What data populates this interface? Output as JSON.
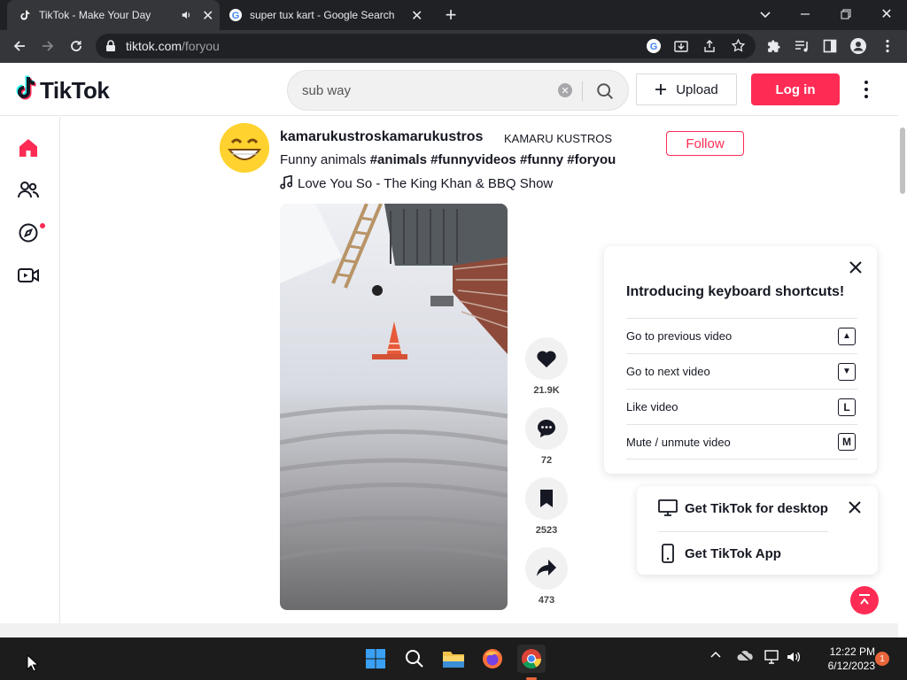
{
  "browser": {
    "tabs": [
      {
        "title": "TikTok - Make Your Day",
        "active": true
      },
      {
        "title": "super tux kart - Google Search",
        "active": false
      }
    ],
    "url_host": "tiktok.com",
    "url_path": "/foryou"
  },
  "header": {
    "logo": "TikTok",
    "search_value": "sub way",
    "upload_label": "Upload",
    "login_label": "Log in"
  },
  "post": {
    "username": "kamarukustroskamarukustros",
    "nickname": "KAMARU KUSTROS",
    "desc_text": "Funny animals ",
    "hashtags": "#animals #funnyvideos #funny #foryou",
    "music": "Love You So - The King Khan & BBQ Show",
    "follow_label": "Follow",
    "likes": "21.9K",
    "comments": "72",
    "saves": "2523",
    "shares": "473"
  },
  "shortcuts": {
    "title": "Introducing keyboard shortcuts!",
    "rows": [
      {
        "label": "Go to previous video",
        "key": "▲"
      },
      {
        "label": "Go to next video",
        "key": "▼"
      },
      {
        "label": "Like video",
        "key": "L"
      },
      {
        "label": "Mute / unmute video",
        "key": "M"
      }
    ]
  },
  "get_app": {
    "desktop_label": "Get TikTok for desktop",
    "app_label": "Get TikTok App"
  },
  "taskbar": {
    "time": "12:22 PM",
    "date": "6/12/2023",
    "notifications": "1"
  },
  "colors": {
    "brand": "#fe2c55",
    "text": "#161823"
  }
}
